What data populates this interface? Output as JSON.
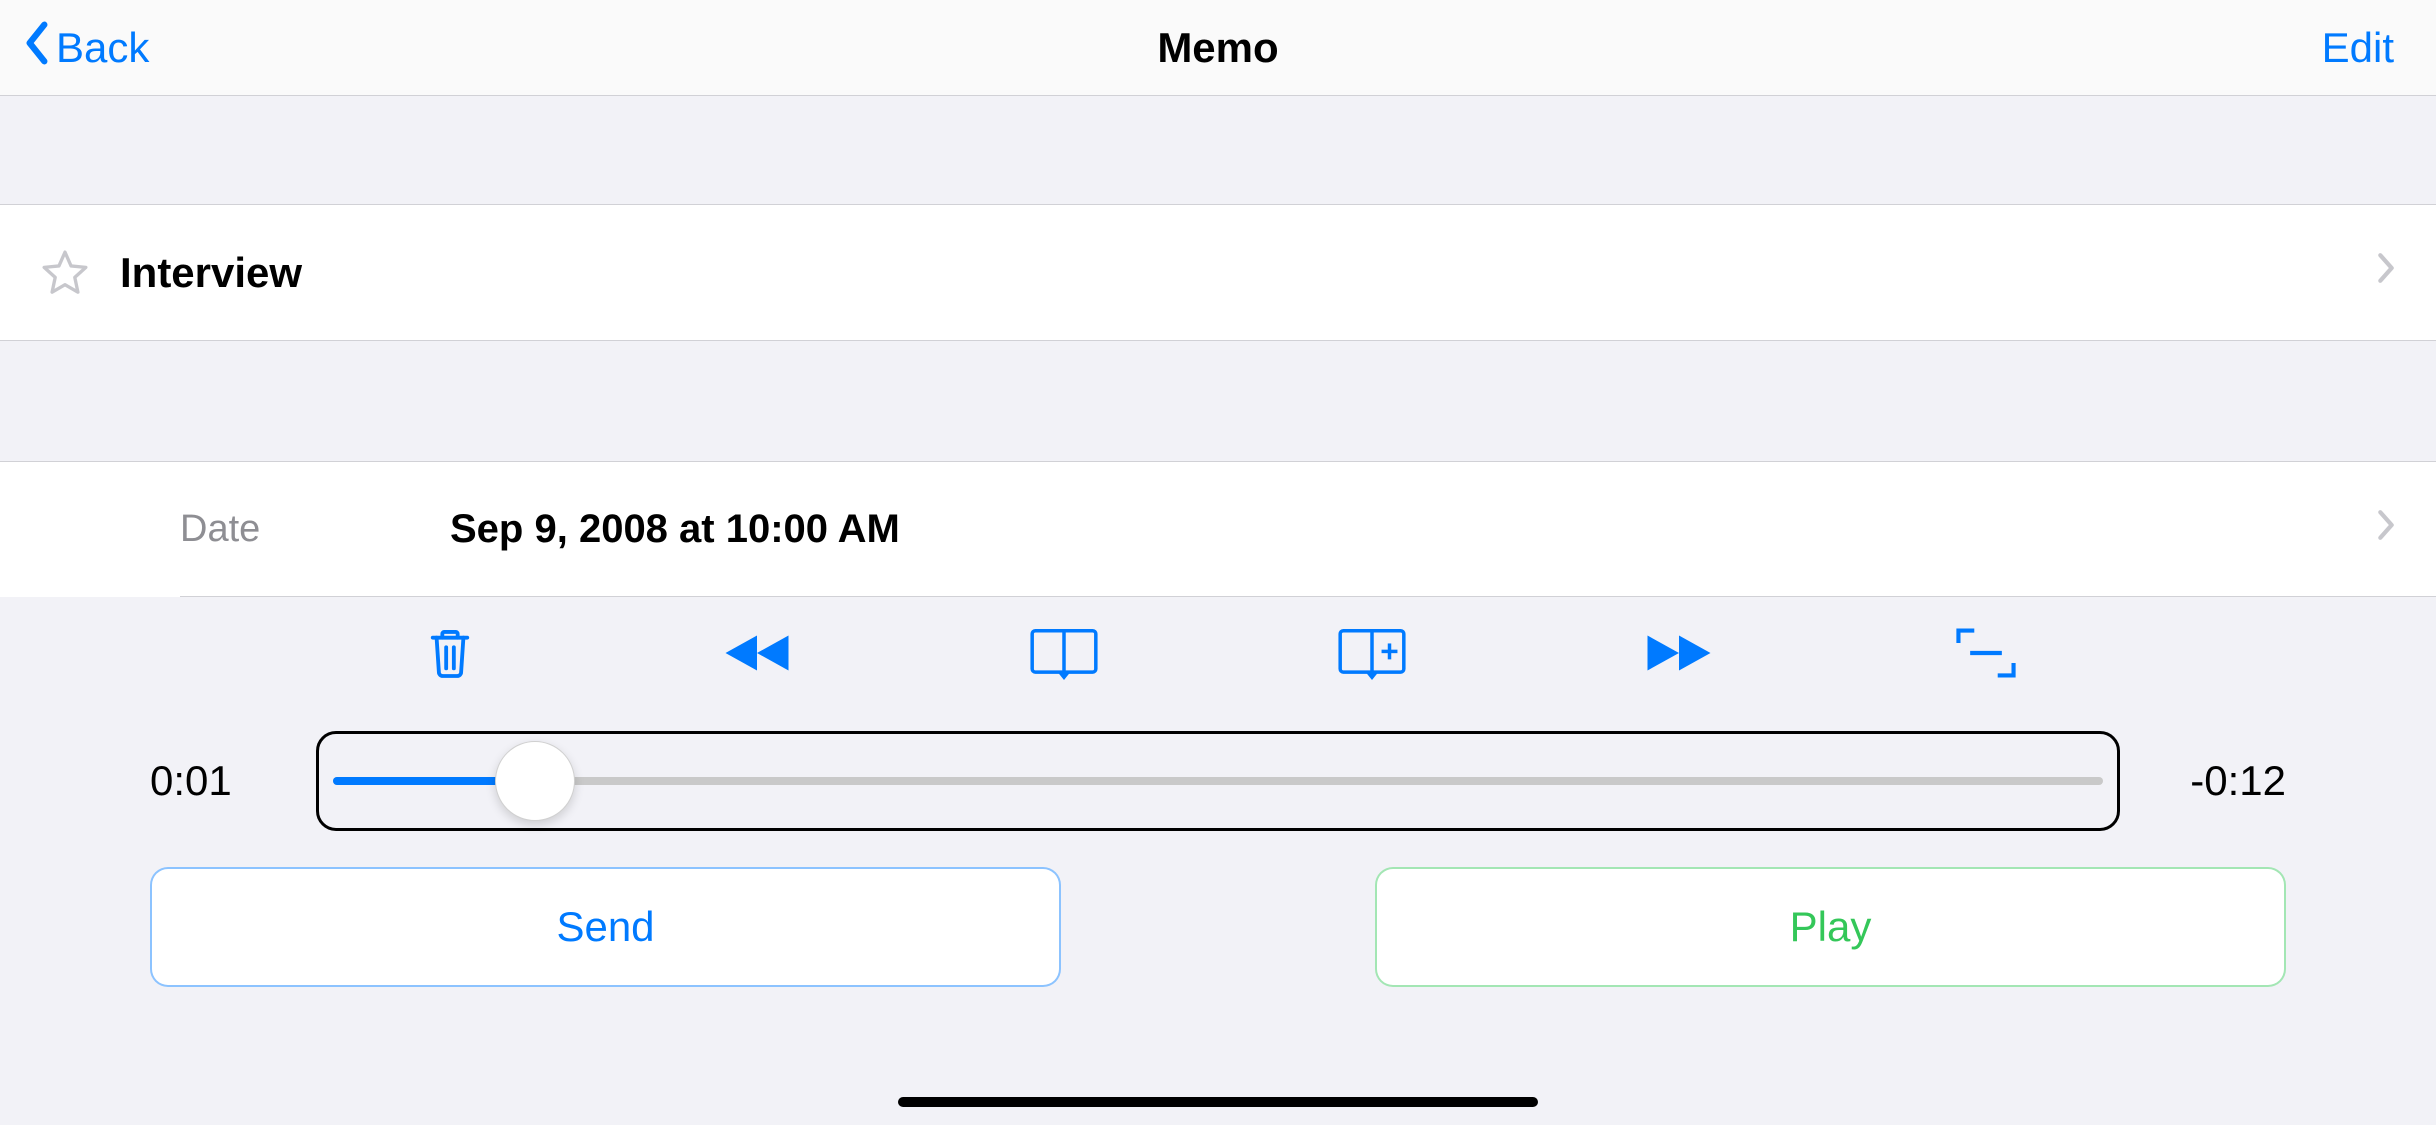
{
  "colors": {
    "accent": "#007aff",
    "success": "#34c759",
    "gray": "#8e8e93"
  },
  "nav": {
    "back_label": "Back",
    "title": "Memo",
    "edit_label": "Edit"
  },
  "memo": {
    "title": "Interview",
    "starred": false
  },
  "date": {
    "label": "Date",
    "value": "Sep 9, 2008 at 10:00 AM"
  },
  "toolbar": {
    "trash": "trash-icon",
    "rewind": "rewind-icon",
    "bookmarks": "bookmarks-icon",
    "add_bookmark": "add-bookmark-icon",
    "forward": "fast-forward-icon",
    "trim": "trim-icon"
  },
  "scrubber": {
    "elapsed": "0:01",
    "remaining": "-0:12",
    "progress_percent": 12
  },
  "actions": {
    "send": "Send",
    "play": "Play"
  }
}
